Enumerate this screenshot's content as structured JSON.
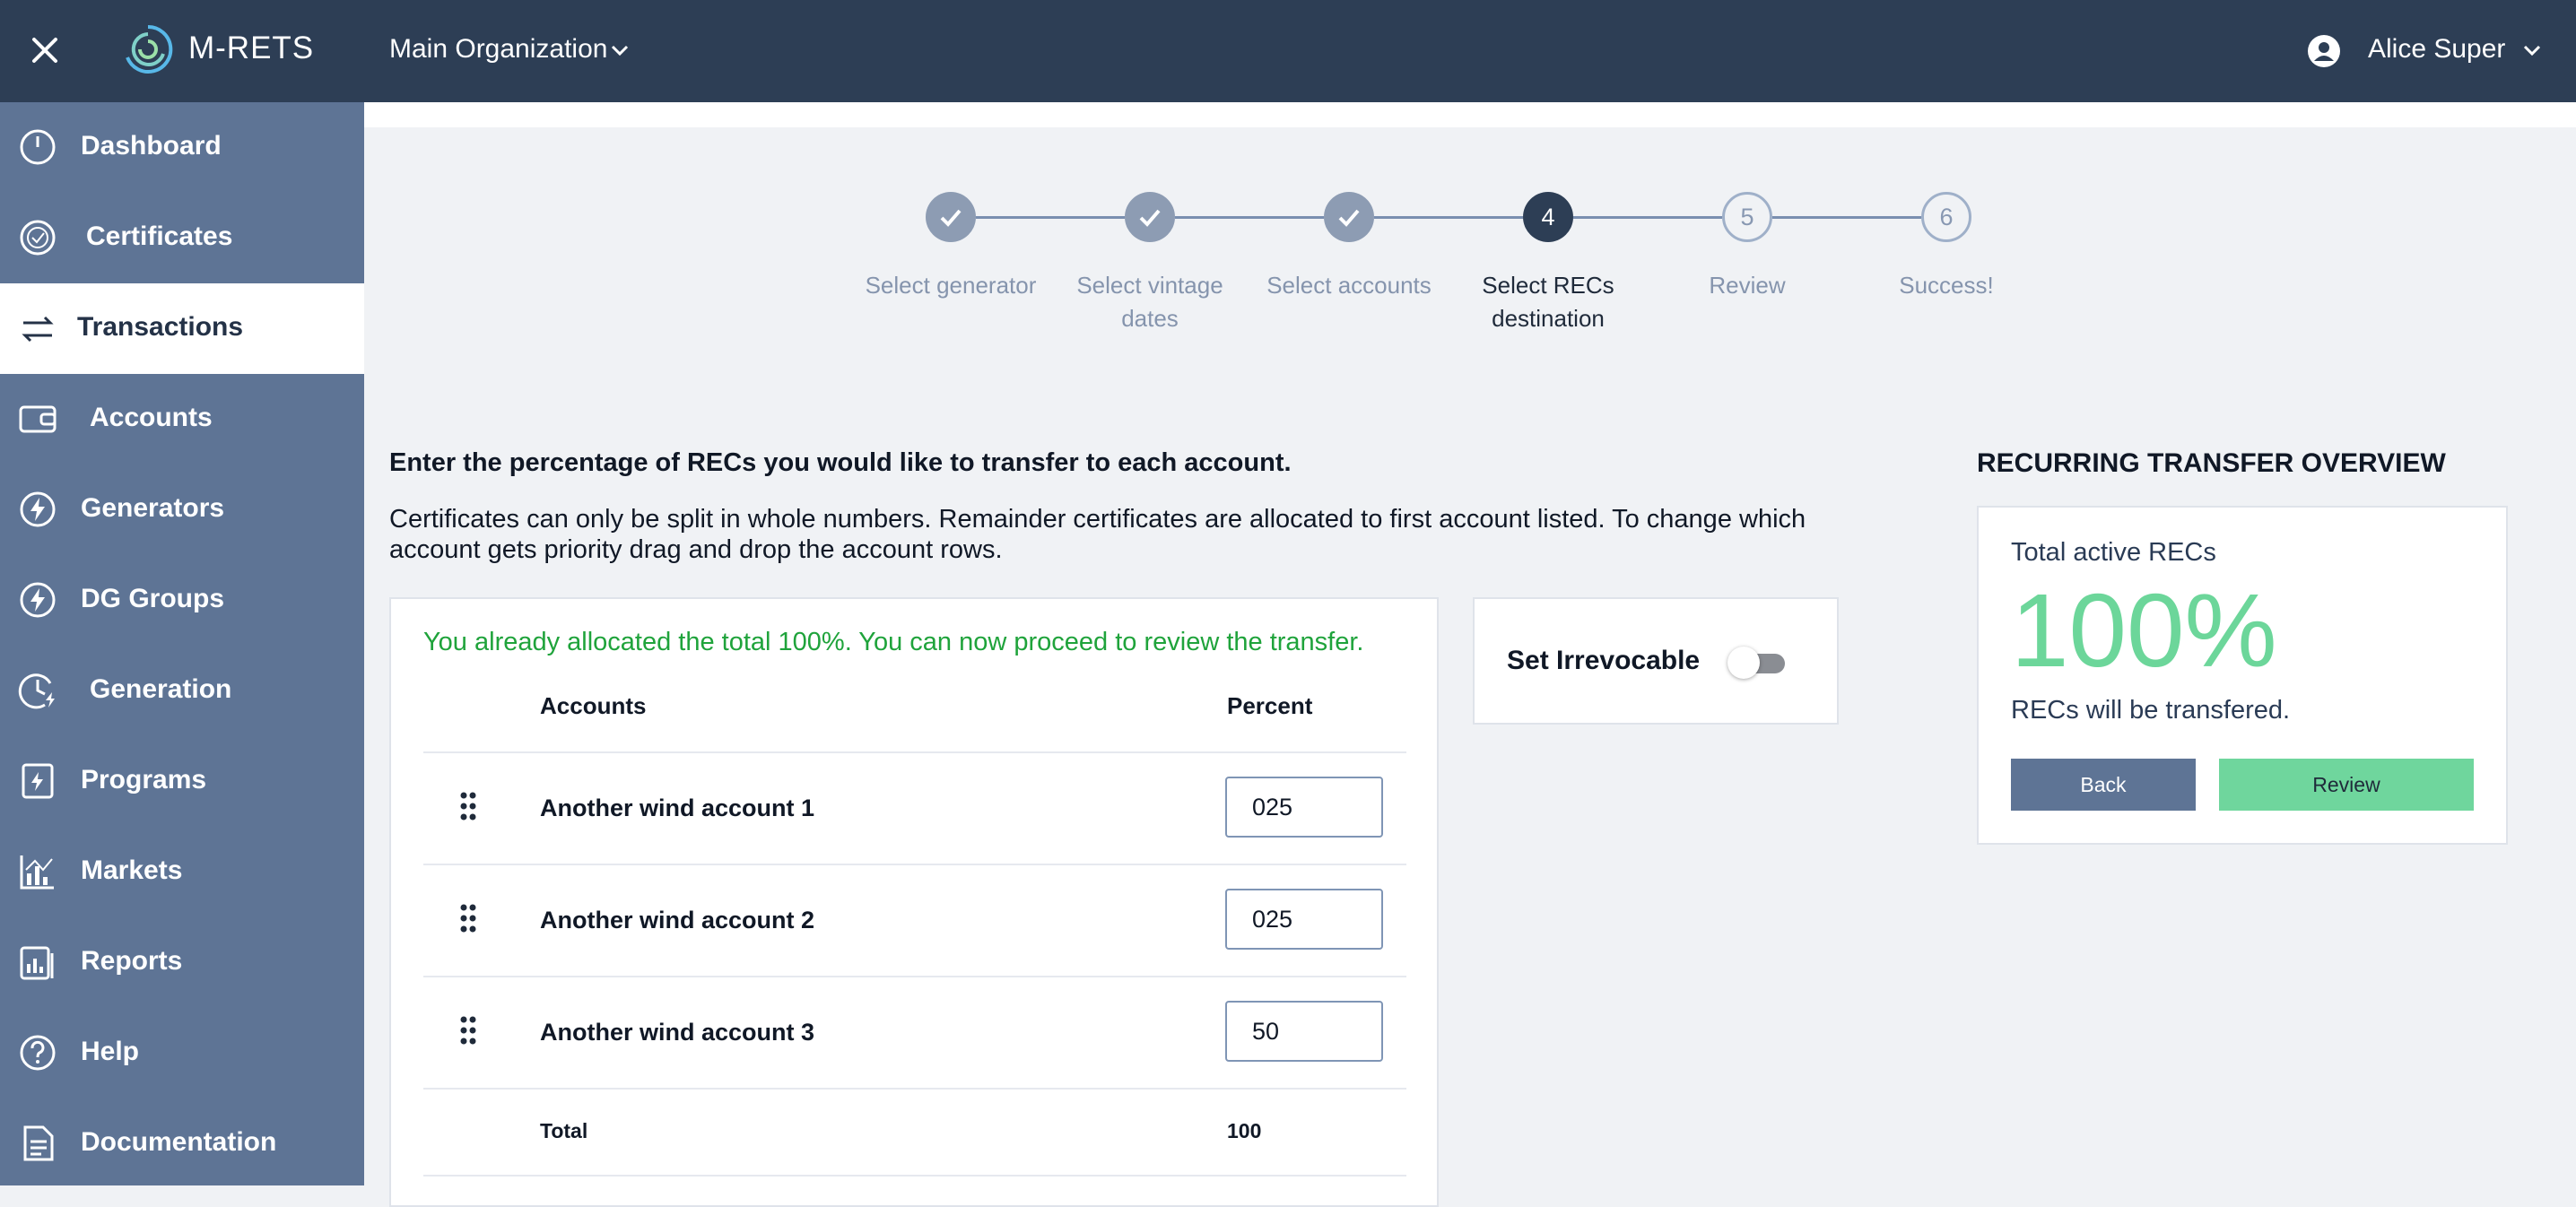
{
  "header": {
    "brand": "M-RETS",
    "organization": "Main Organization",
    "user_name": "Alice Super"
  },
  "sidebar": {
    "items": [
      {
        "label": "Dashboard",
        "icon": "dashboard-icon"
      },
      {
        "label": "Certificates",
        "icon": "certificate-icon"
      },
      {
        "label": "Transactions",
        "icon": "transfer-arrows-icon",
        "active": true
      },
      {
        "label": "Accounts",
        "icon": "wallet-icon"
      },
      {
        "label": "Generators",
        "icon": "lightning-icon"
      },
      {
        "label": "DG Groups",
        "icon": "lightning-icon"
      },
      {
        "label": "Generation",
        "icon": "clock-lightning-icon"
      },
      {
        "label": "Programs",
        "icon": "document-lightning-icon"
      },
      {
        "label": "Markets",
        "icon": "bar-chart-icon"
      },
      {
        "label": "Reports",
        "icon": "report-icon"
      },
      {
        "label": "Help",
        "icon": "question-icon"
      },
      {
        "label": "Documentation",
        "icon": "document-icon"
      }
    ]
  },
  "stepper": {
    "steps": [
      {
        "label": "Select generator",
        "state": "done"
      },
      {
        "label": "Select vintage dates",
        "state": "done"
      },
      {
        "label": "Select accounts",
        "state": "done"
      },
      {
        "label": "Select RECs destination",
        "number": "4",
        "state": "current"
      },
      {
        "label": "Review",
        "number": "5",
        "state": "todo"
      },
      {
        "label": "Success!",
        "number": "6",
        "state": "todo"
      }
    ]
  },
  "main": {
    "heading": "Enter the percentage of RECs you would like to transfer to each account.",
    "description": "Certificates can only be split in whole numbers. Remainder certificates are allocated to first account listed. To change which account gets priority drag and drop the account rows."
  },
  "allocation": {
    "message": "You already allocated the total 100%. You can now proceed to review the transfer.",
    "columns": {
      "accounts": "Accounts",
      "percent": "Percent"
    },
    "rows": [
      {
        "name": "Another wind account 1",
        "percent": "025"
      },
      {
        "name": "Another wind account 2",
        "percent": "025"
      },
      {
        "name": "Another wind account 3",
        "percent": "50"
      }
    ],
    "total_label": "Total",
    "total_value": "100"
  },
  "irrevocable": {
    "label": "Set Irrevocable",
    "enabled": false
  },
  "overview": {
    "heading": "RECURRING TRANSFER OVERVIEW",
    "subtitle": "Total active RECs",
    "big_value": "100%",
    "note": "RECs will be transfered.",
    "back_label": "Back",
    "review_label": "Review"
  },
  "colors": {
    "topbar": "#2d3e55",
    "sidebar": "#5e7495",
    "success_text": "#1fa33b",
    "accent_green": "#6fd69d"
  }
}
